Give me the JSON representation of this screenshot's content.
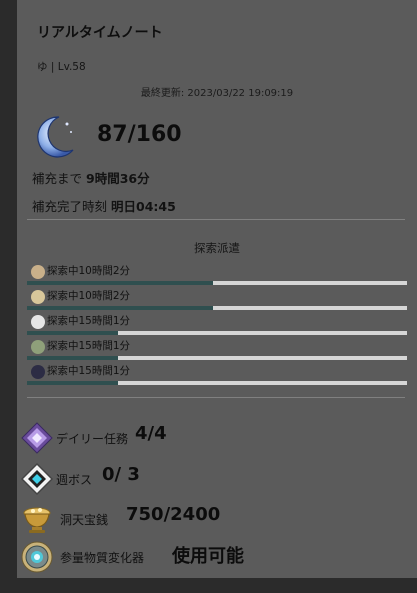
{
  "header": {
    "title": "リアルタイムノート",
    "player": "ゆ | Lv.58",
    "last_updated": "最終更新: 2023/03/22 19:09:19"
  },
  "resin": {
    "icon": "crescent-moon-icon",
    "value": "87/160",
    "refill_label": "補充まで",
    "refill_time": "9時間36分",
    "full_label": "補充完了時刻",
    "full_time": "明日04:45"
  },
  "expeditions": {
    "title": "探索派遣",
    "items": [
      {
        "label": "探索中10時間2分",
        "avatar_color": "#c9b08a",
        "progress": 0.49
      },
      {
        "label": "探索中10時間2分",
        "avatar_color": "#d8c79a",
        "progress": 0.49
      },
      {
        "label": "探索中15時間1分",
        "avatar_color": "#e6e6e6",
        "progress": 0.24
      },
      {
        "label": "探索中15時間1分",
        "avatar_color": "#8fa07a",
        "progress": 0.24
      },
      {
        "label": "探索中15時間1分",
        "avatar_color": "#2c2c44",
        "progress": 0.24
      }
    ]
  },
  "stats": {
    "daily": {
      "name": "デイリー任務",
      "value": "4/4",
      "icon": "daily-commission-icon"
    },
    "weekly_boss": {
      "name": "週ボス",
      "value": "0/ 3",
      "icon": "weekly-boss-icon"
    },
    "realm_currency": {
      "name": "洞天宝銭",
      "value": "750/2400",
      "icon": "realm-currency-icon"
    },
    "transformer": {
      "name": "参量物質変化器",
      "value": "使用可能",
      "icon": "parametric-transformer-icon"
    }
  }
}
